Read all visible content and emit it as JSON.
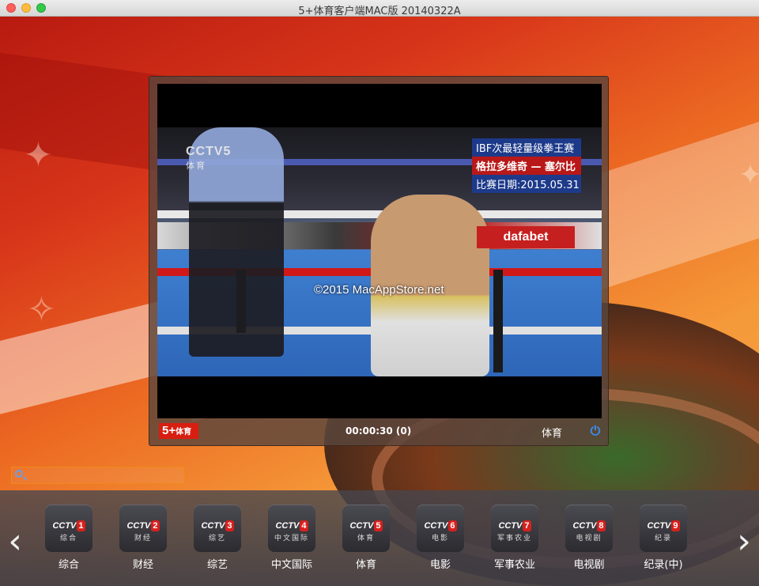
{
  "window": {
    "title": "5+体育客户端MAC版 20140322A"
  },
  "player": {
    "video": {
      "channel_logo": "CCTV5",
      "channel_logo_sub": "体育",
      "overlay_line1": "IBF次最轻量级拳王赛",
      "overlay_line2": "格拉多维奇 — 塞尔比",
      "overlay_line3": "比赛日期:2015.05.31",
      "sponsor": "dafabet",
      "watermark": "©2015 MacAppStore.net"
    },
    "controls": {
      "brand_main": "5+",
      "brand_sub": "体育",
      "time": "00:00:30 (0)",
      "category": "体育",
      "power_icon": "power-icon"
    }
  },
  "search": {
    "value": "",
    "placeholder": ""
  },
  "channels": {
    "items": [
      {
        "num": "1",
        "sub": "综合",
        "name": "综合"
      },
      {
        "num": "2",
        "sub": "财经",
        "name": "财经"
      },
      {
        "num": "3",
        "sub": "综艺",
        "name": "综艺"
      },
      {
        "num": "4",
        "sub": "中文国际",
        "name": "中文国际"
      },
      {
        "num": "5",
        "sub": "体育",
        "name": "体育"
      },
      {
        "num": "6",
        "sub": "电影",
        "name": "电影"
      },
      {
        "num": "7",
        "sub": "军事农业",
        "name": "军事农业"
      },
      {
        "num": "8",
        "sub": "电视剧",
        "name": "电视剧"
      },
      {
        "num": "9",
        "sub": "纪录",
        "name": "纪录(中)"
      }
    ],
    "badge_prefix": "CCTV"
  },
  "colors": {
    "accent": "#ee8a18",
    "brand_red": "#d81e10",
    "power_blue": "#3a8df0"
  }
}
